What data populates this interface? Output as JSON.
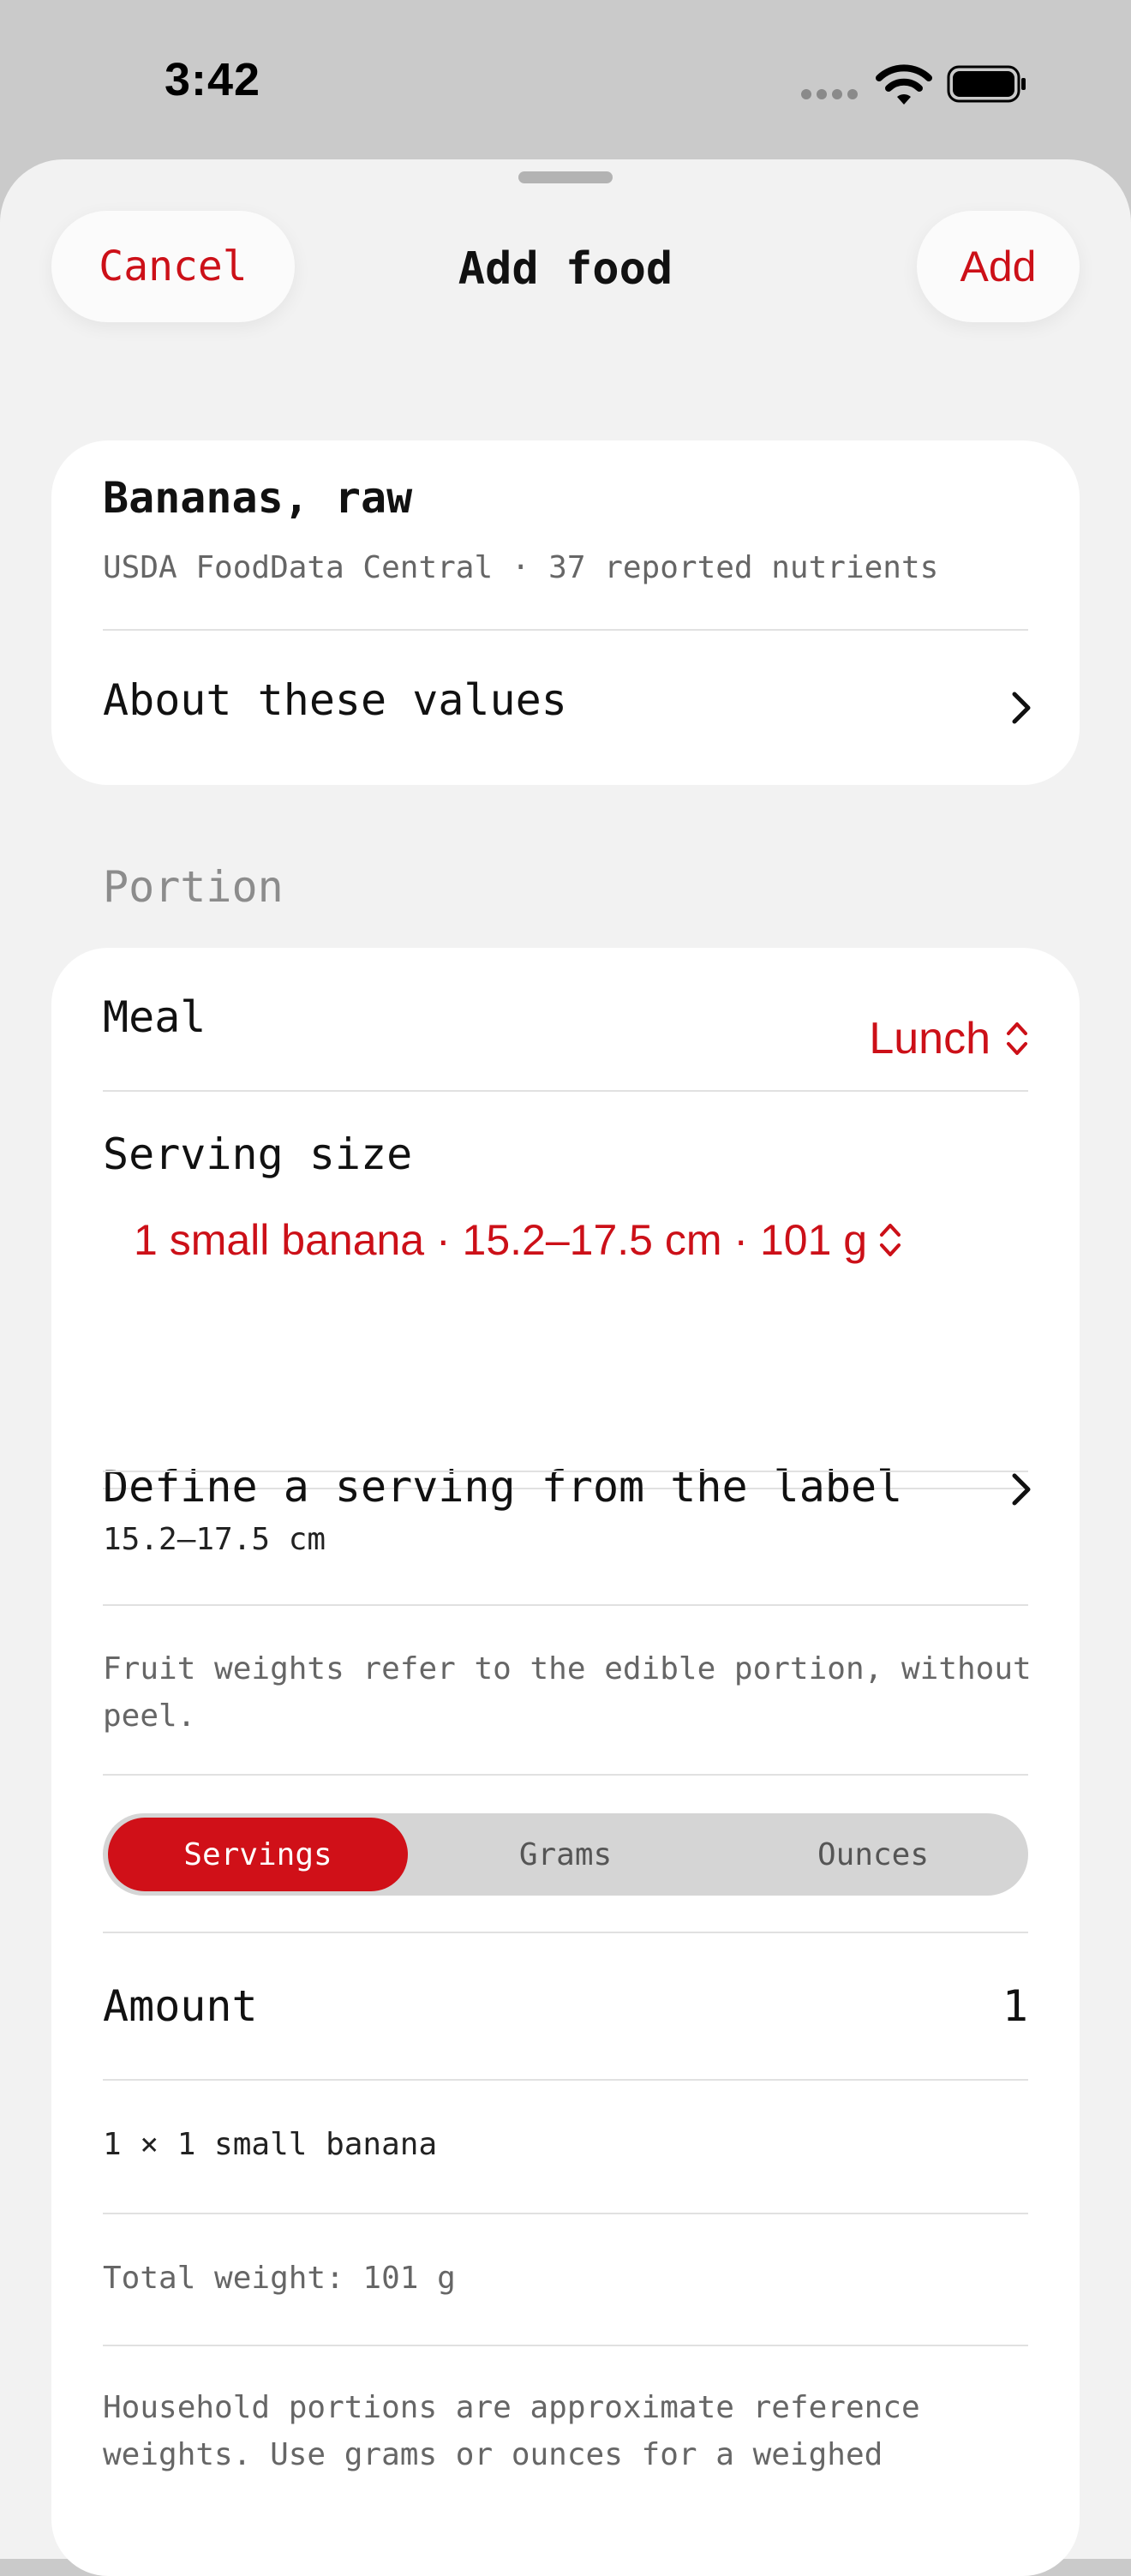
{
  "status_bar": {
    "time": "3:42"
  },
  "nav": {
    "cancel_label": "Cancel",
    "title": "Add food",
    "add_label": "Add"
  },
  "food": {
    "name": "Bananas, raw",
    "source": "USDA FoodData Central · 37 reported nutrients",
    "about_label": "About these values"
  },
  "portion": {
    "section_title": "Portion",
    "meal_label": "Meal",
    "meal_value": "Lunch",
    "serving_size_label": "Serving size",
    "serving_size_value": "1 small banana · 15.2–17.5 cm · 101 g",
    "define_serving_label": "Define a serving from the label",
    "dimension_text": "15.2–17.5 cm",
    "fruit_note": "Fruit weights refer to the edible portion, without peel.",
    "unit_options": [
      "Servings",
      "Grams",
      "Ounces"
    ],
    "unit_selected": "Servings",
    "amount_label": "Amount",
    "amount_value": "1",
    "calc_text": "1 × 1 small banana",
    "total_weight": "Total weight: 101 g",
    "household_note": "Household portions are approximate reference weights. Use grams or ounces for a weighed"
  },
  "colors": {
    "accent": "#cc1018",
    "sheet_bg": "#f2f2f2",
    "card_bg": "#ffffff"
  }
}
